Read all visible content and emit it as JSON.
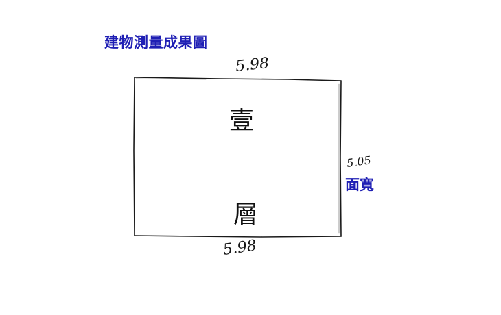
{
  "title": "建物測量成果圖",
  "frontage_label": "面寬",
  "floor": {
    "line1": "壹",
    "line2": "層"
  },
  "dimensions": {
    "top": "5.98",
    "bottom": "5.98",
    "right": "5.05"
  },
  "colors": {
    "label": "#1f1fb4",
    "ink": "#151515"
  }
}
